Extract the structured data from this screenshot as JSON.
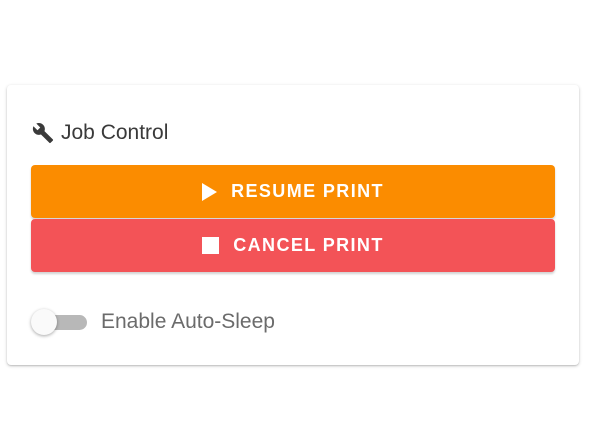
{
  "card": {
    "title": "Job Control",
    "title_icon": "wrench-icon"
  },
  "buttons": {
    "resume": {
      "label": "RESUME PRINT",
      "icon": "play-icon",
      "color": "#fb8c00"
    },
    "cancel": {
      "label": "CANCEL PRINT",
      "icon": "stop-icon",
      "color": "#f35357"
    }
  },
  "auto_sleep": {
    "label": "Enable Auto-Sleep",
    "enabled": false
  }
}
